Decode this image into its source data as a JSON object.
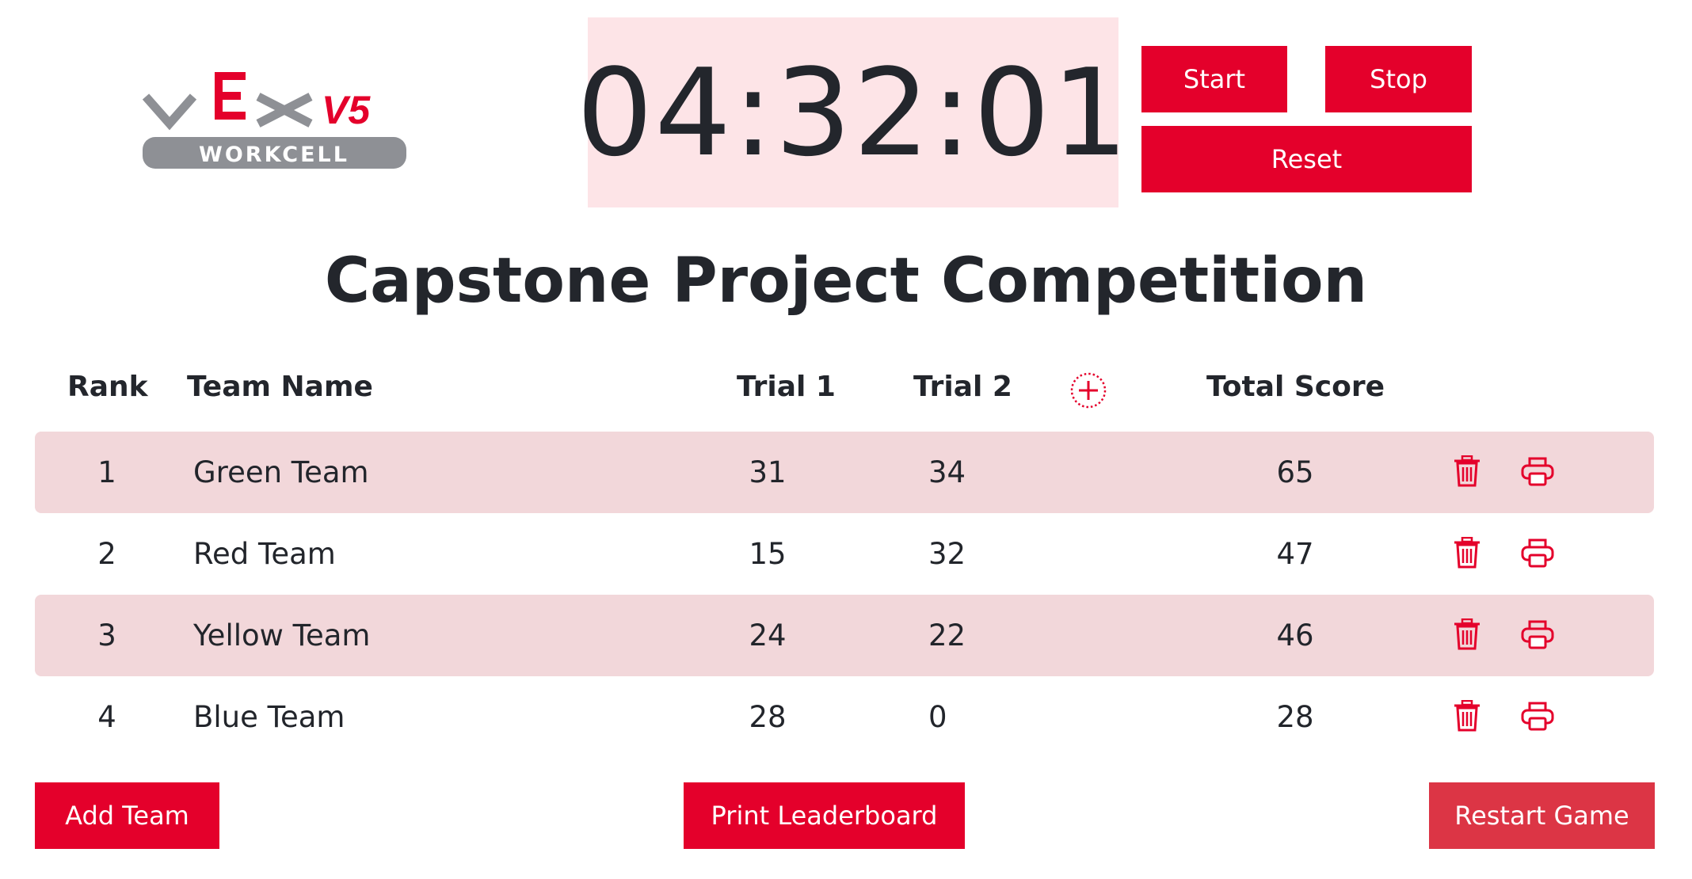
{
  "logo": {
    "brand": "VEX V5",
    "sub": "WORKCELL"
  },
  "timer": {
    "display": "04:32:01"
  },
  "controls": {
    "start_label": "Start",
    "stop_label": "Stop",
    "reset_label": "Reset"
  },
  "title": "Capstone Project Competition",
  "table": {
    "headers": {
      "rank": "Rank",
      "team": "Team Name",
      "trial1": "Trial 1",
      "trial2": "Trial 2",
      "total": "Total Score"
    },
    "rows": [
      {
        "rank": "1",
        "team": "Green Team",
        "trial1": "31",
        "trial2": "34",
        "total": "65"
      },
      {
        "rank": "2",
        "team": "Red Team",
        "trial1": "15",
        "trial2": "32",
        "total": "47"
      },
      {
        "rank": "3",
        "team": "Yellow Team",
        "trial1": "24",
        "trial2": "22",
        "total": "46"
      },
      {
        "rank": "4",
        "team": "Blue Team",
        "trial1": "28",
        "trial2": "0",
        "total": "28"
      }
    ]
  },
  "footer": {
    "add_team_label": "Add Team",
    "print_label": "Print Leaderboard",
    "restart_label": "Restart Game"
  },
  "colors": {
    "accent": "#e4002b",
    "row_alt": "#f2d7da",
    "timer_bg": "#fde4e7",
    "restart": "#dc3545"
  },
  "icons": {
    "add_trial": "plus-circle-icon",
    "delete": "trash-icon",
    "print": "printer-icon"
  }
}
